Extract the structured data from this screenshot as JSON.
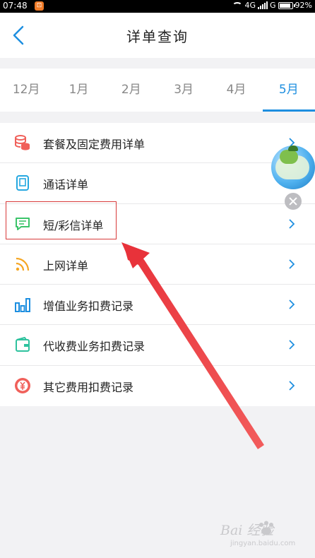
{
  "status_bar": {
    "time": "07:48",
    "notification_badge": "⊡",
    "network": "4G",
    "network2": "G",
    "battery": "92%"
  },
  "header": {
    "title": "详单查询"
  },
  "month_tabs": {
    "items": [
      {
        "label": "12月"
      },
      {
        "label": "1月"
      },
      {
        "label": "2月"
      },
      {
        "label": "3月"
      },
      {
        "label": "4月"
      },
      {
        "label": "5月"
      }
    ],
    "selected": "5月"
  },
  "list": {
    "items": [
      {
        "label": "套餐及固定费用详单",
        "icon": "coin-stack-icon",
        "icon_color": "#f0605a"
      },
      {
        "label": "通话详单",
        "icon": "phone-icon",
        "icon_color": "#26a8e0"
      },
      {
        "label": "短/彩信详单",
        "icon": "message-icon",
        "icon_color": "#3cc46a"
      },
      {
        "label": "上网详单",
        "icon": "rss-icon",
        "icon_color": "#f5a623"
      },
      {
        "label": "增值业务扣费记录",
        "icon": "bar-chart-icon",
        "icon_color": "#1e8fe0"
      },
      {
        "label": "代收费业务扣费记录",
        "icon": "wallet-icon",
        "icon_color": "#2ec29e"
      },
      {
        "label": "其它费用扣费记录",
        "icon": "yen-icon",
        "icon_color": "#f0605a"
      }
    ]
  },
  "watermark": {
    "line1": "Bai  经验",
    "line2": "jingyan.baidu.com"
  },
  "colors": {
    "accent": "#1e8fe0",
    "highlight": "#d83a3a"
  }
}
